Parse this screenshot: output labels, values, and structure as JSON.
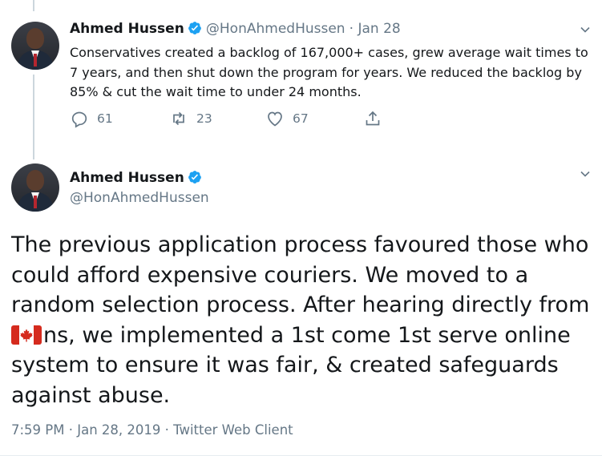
{
  "tweet1": {
    "name": "Ahmed Hussen",
    "handle": "@HonAhmedHussen",
    "date": "Jan 28",
    "text": "Conservatives created a backlog of 167,000+ cases, grew average wait times to 7 years, and then shut down the program for years. We reduced the backlog by 85% & cut the wait time to under 24 months.",
    "reply_count": "61",
    "retweet_count": "23",
    "like_count": "67"
  },
  "tweet2": {
    "name": "Ahmed Hussen",
    "handle": "@HonAhmedHussen",
    "text_part1": "The previous application process favoured those who could afford expensive couriers.  We moved to a random selection process.  After hearing directly from ",
    "text_part2": "ns, we implemented a 1st come 1st serve online system to ensure it was fair, & created safeguards against abuse.",
    "timestamp": "7:59 PM · Jan 28, 2019 · Twitter Web Client"
  },
  "colors": {
    "accent": "#1da1f2",
    "muted": "#657786",
    "text": "#14171a",
    "flag_red": "#d52b1e"
  }
}
